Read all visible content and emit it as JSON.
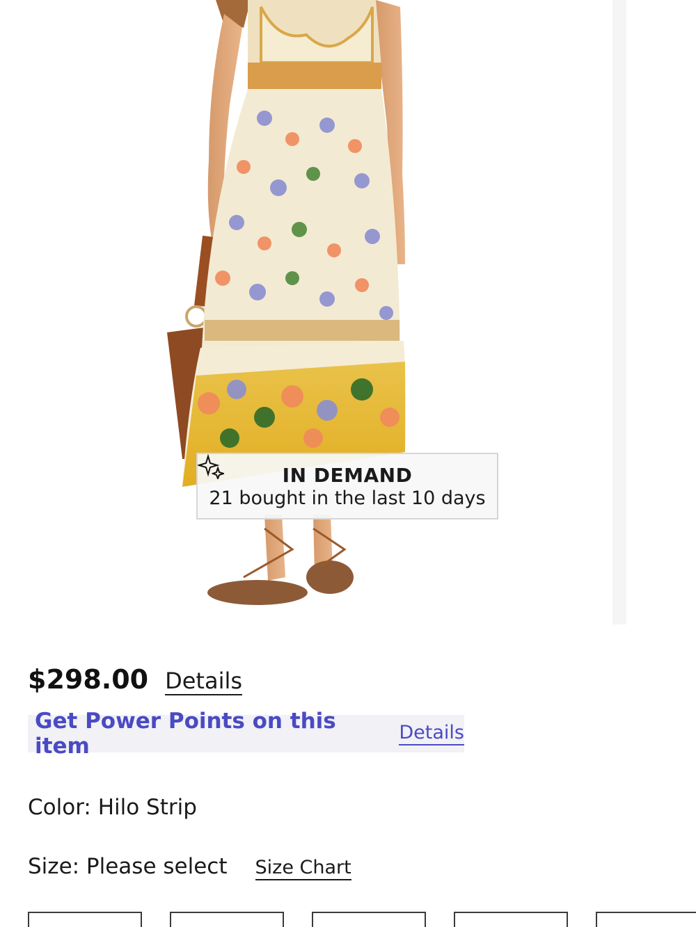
{
  "product_image": {
    "alt": "",
    "badge": {
      "icon": "sparkle-icon",
      "title": "IN DEMAND",
      "subtitle": "21 bought in the last 10 days"
    }
  },
  "pricing": {
    "price": "$298.00",
    "details_link": "Details"
  },
  "power_points": {
    "text": "Get Power Points on this item",
    "details_link": "Details",
    "accent_color": "#4a4ac4"
  },
  "color": {
    "label": "Color: ",
    "value": "Hilo Strip"
  },
  "size": {
    "label": "Size: Please select",
    "size_chart_link": "Size Chart",
    "options_visible_count": 5
  }
}
